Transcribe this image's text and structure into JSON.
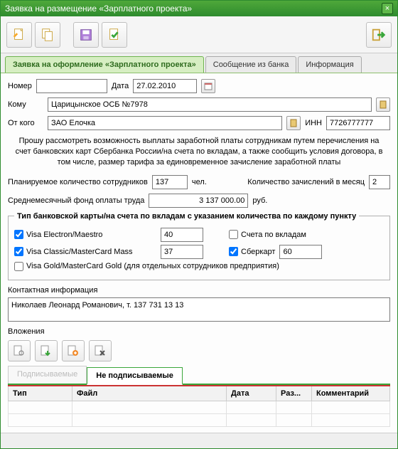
{
  "window": {
    "title": "Заявка на размещение «Зарплатного проекта»"
  },
  "tabs": {
    "t1": "Заявка на оформление «Зарплатного проекта»",
    "t2": "Сообщение из банка",
    "t3": "Информация"
  },
  "labels": {
    "number": "Номер",
    "date": "Дата",
    "to": "Кому",
    "from": "От кого",
    "inn": "ИНН",
    "planned": "Планируемое количество сотрудников",
    "persons": "чел.",
    "per_month": "Количество зачислений в месяц",
    "avg_fund": "Среднемесячный фонд оплаты труда",
    "rub": "руб.",
    "legend": "Тип банковской карты/на счета по вкладам с указанием количества по каждому пункту",
    "visa_electron": "Visa Electron/Maestro",
    "visa_classic": "Visa Classic/MasterCard Mass",
    "visa_gold": "Visa Gold/MasterCard Gold (для отдельных сотрудников предприятия)",
    "deposit_acc": "Счета по вкладам",
    "sbercard": "Сберкарт",
    "contact": "Контактная информация",
    "attachments": "Вложения"
  },
  "values": {
    "number": "",
    "date": "27.02.2010",
    "to": "Царицынское ОСБ №7978",
    "from": "ЗАО Елочка",
    "inn": "7726777777",
    "planned": "137",
    "per_month": "2",
    "avg_fund": "3 137 000.00",
    "visa_electron_qty": "40",
    "visa_classic_qty": "37",
    "sbercard_qty": "60",
    "contact_text": "Николаев Леонард Романович, т. 137 731 13 13"
  },
  "checked": {
    "visa_electron": true,
    "visa_classic": true,
    "visa_gold": false,
    "deposit_acc": false,
    "sbercard": true
  },
  "blurb": "Прошу рассмотреть возможность выплаты заработной платы сотрудникам путем перечисления на счет банковских карт Сбербанка России/на счета по вкладам, а также сообщить условия договора, в том числе, размер тарифа за единовременное зачисление заработной платы",
  "subtabs": {
    "signable": "Подписываемые",
    "unsignable": "Не подписываемые"
  },
  "gridcols": {
    "type": "Тип",
    "file": "Файл",
    "date": "Дата",
    "size": "Раз...",
    "comment": "Комментарий"
  }
}
